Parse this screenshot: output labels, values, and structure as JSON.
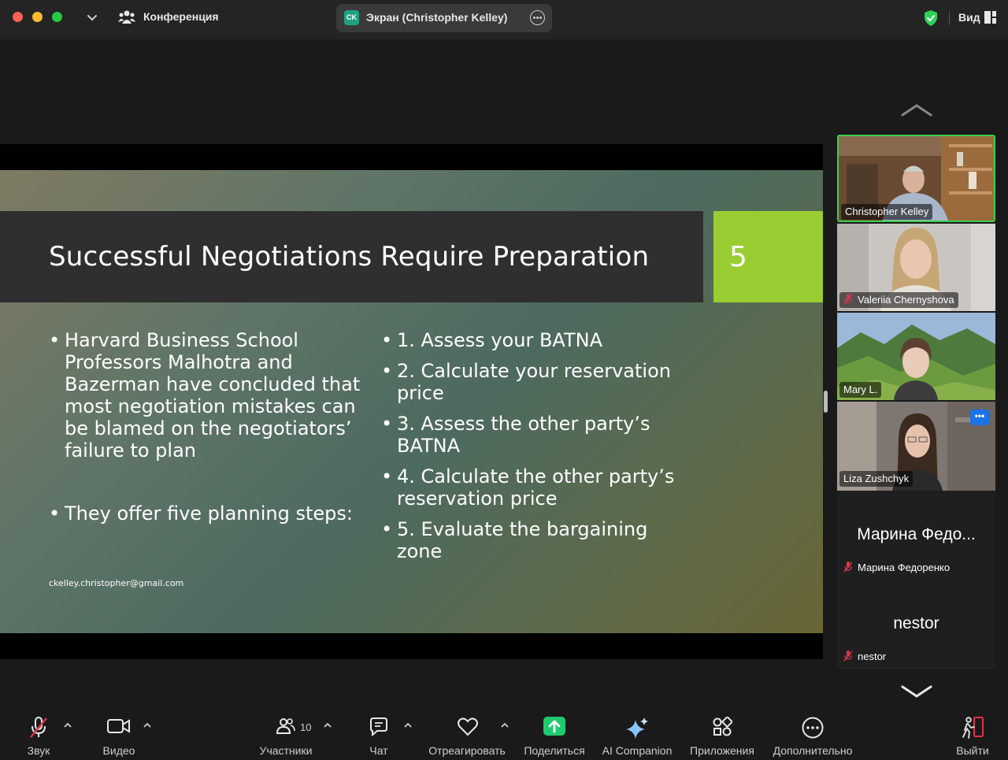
{
  "titlebar": {
    "conference_label": "Конференция",
    "share_badge": "CK",
    "share_label": "Экран (Christopher Kelley)",
    "view_label": "Вид"
  },
  "slide": {
    "title": "Successful Negotiations Require Preparation",
    "number": "5",
    "left_bullets": [
      "Harvard Business School Professors Malhotra and Bazerman have concluded that most negotiation mistakes can be blamed on the negotiators’ failure to plan",
      "They offer five planning steps:"
    ],
    "right_bullets": [
      "1. Assess your BATNA",
      "2. Calculate your reservation price",
      "3. Assess the other party’s BATNA",
      "4. Calculate the other party’s reservation price",
      "5. Evaluate the bargaining zone"
    ],
    "email": "ckelley.christopher@gmail.com"
  },
  "participants": [
    {
      "name": "Christopher Kelley",
      "muted": false,
      "active_speaker": true
    },
    {
      "name": "Valeriia Chernyshova",
      "muted": true
    },
    {
      "name": "Mary L.",
      "muted": false
    },
    {
      "name": "Liza Zushchyk",
      "muted": false
    },
    {
      "name": "Марина Федоренко",
      "display_big": "Марина Федо...",
      "muted": true
    },
    {
      "name": "nestor",
      "display_big": "nestor",
      "muted": true
    }
  ],
  "toolbar": {
    "audio": "Звук",
    "video": "Видео",
    "participants": "Участники",
    "participants_count": "10",
    "chat": "Чат",
    "react": "Отреагировать",
    "share": "Поделиться",
    "ai": "AI Companion",
    "apps": "Приложения",
    "more": "Дополнительно",
    "leave": "Выйти"
  },
  "colors": {
    "active_speaker_border": "#3ccf4e",
    "share_accent": "#1fca6f",
    "slide_number_bg": "#9acd32",
    "muted_red": "#e0344a"
  }
}
